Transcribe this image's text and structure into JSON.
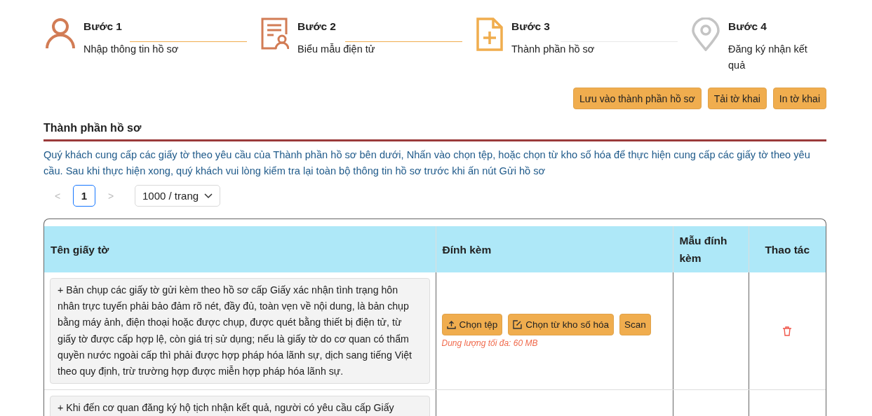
{
  "steps": [
    {
      "title": "Bước 1",
      "label": "Nhập thông tin hồ sơ",
      "done": true,
      "current": false
    },
    {
      "title": "Bước 2",
      "label": "Biểu mẫu điện tử",
      "done": true,
      "current": false
    },
    {
      "title": "Bước 3",
      "label": "Thành phần hồ sơ",
      "done": false,
      "current": true
    },
    {
      "title": "Bước 4",
      "label": "Đăng ký nhận kết quả",
      "done": false,
      "current": false
    }
  ],
  "actions": [
    "Lưu vào thành phần hồ sơ",
    "Tải tờ khai",
    "In tờ khai"
  ],
  "section": {
    "title": "Thành phần hồ sơ",
    "description": "Quý khách cung cấp các giấy tờ theo yêu cầu của Thành phần hồ sơ bên dưới, Nhấn vào chọn tệp, hoặc chọn từ kho số hóa để thực hiện cung cấp các giấy tờ theo yêu cầu. Sau khi thực hiện xong, quý khách vui lòng kiểm tra lại toàn bộ thông tin hồ sơ trước khi ấn nút Gửi hồ sơ"
  },
  "pagination": {
    "prev": "<",
    "pages": [
      {
        "label": "1",
        "selected": true
      }
    ],
    "next": ">",
    "page_size": "1000 / trang"
  },
  "table": {
    "columns": [
      "Tên giấy tờ",
      "Đính kèm",
      "Mẫu đính kèm",
      "Thao tác"
    ],
    "rows": [
      {
        "name": "+ Bản chụp các giấy tờ gửi kèm theo hồ sơ cấp Giấy xác nhận tình trạng hôn nhân trực tuyến phải bảo đảm rõ nét, đầy đủ, toàn vẹn về nội dung, là bản chụp bằng máy ảnh, điện thoại hoặc được chụp, được quét bằng thiết bị điện tử, từ giấy tờ được cấp hợp lệ, còn giá trị sử dụng; nếu là giấy tờ do cơ quan có thẩm quyền nước ngoài cấp thì phải được hợp pháp hóa lãnh sự, dịch sang tiếng Việt theo quy định, trừ trường hợp được miễn hợp pháp hóa lãnh sự.",
        "buttons": [
          {
            "kind": "upload",
            "label": "Chọn tệp"
          },
          {
            "kind": "repository",
            "label": "Chọn từ kho số hóa"
          },
          {
            "kind": "plain",
            "label": "Scan"
          }
        ],
        "note": "Dung lượng tối đa: 60 MB",
        "deletable": true
      },
      {
        "name": "+ Khi đến cơ quan đăng ký hộ tịch nhận kết quả, người có yêu cầu cấp Giấy"
      }
    ]
  }
}
